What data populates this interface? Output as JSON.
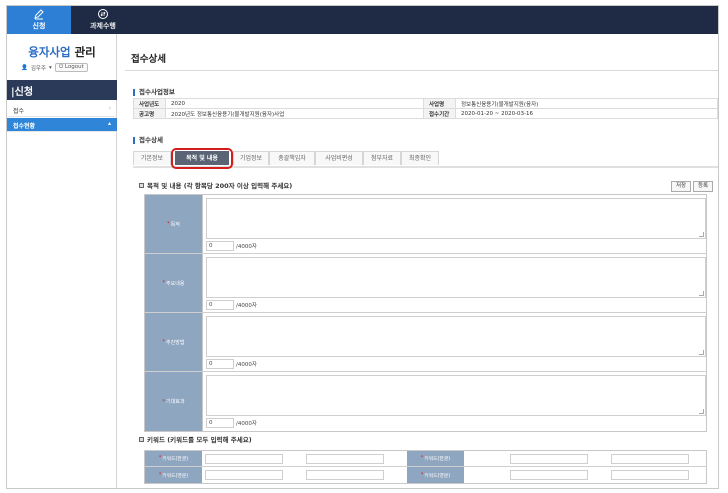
{
  "topnav": {
    "items": [
      {
        "label": "신청",
        "icon": "pencil-icon",
        "active": true
      },
      {
        "label": "과제수행",
        "icon": "cycle-icon",
        "active": false
      }
    ]
  },
  "sidebar": {
    "title_highlight": "융자사업",
    "title_rest": " 관리",
    "user_name": "김우주",
    "logout_label": "Logout",
    "section_label": "신청",
    "items": [
      {
        "label": "접수",
        "active": false
      },
      {
        "label": "접수현황",
        "active": true
      }
    ]
  },
  "main": {
    "page_title": "접수상세",
    "info_section_title": "접수사업정보",
    "info": {
      "row1": {
        "k1": "사업년도",
        "v1": "2020",
        "k2": "사업명",
        "v2": "정보통신융용기(물개발지원(융자)"
      },
      "row2": {
        "k1": "공고명",
        "v1": "2020년도 정보통신융용기(물개발지원(융자)사업",
        "k2": "접수기간",
        "v2": "2020-01-20 ~ 2020-03-16"
      }
    },
    "detail_section_title": "접수상세",
    "tabs": [
      "기본정보",
      "목적 및 내용",
      "기업정보",
      "총괄책임자",
      "사업비편성",
      "첨부자료",
      "최종확인"
    ],
    "active_tab_index": 1,
    "purpose": {
      "title": "목적 및 내용 (각 항목당 200자 이상 입력해 주세요)",
      "save_label": "저장",
      "register_label": "등록",
      "fields": [
        {
          "label": "목적",
          "count": "0",
          "limit": "/4000자"
        },
        {
          "label": "주요내용",
          "count": "0",
          "limit": "/4000자"
        },
        {
          "label": "추진방법",
          "count": "0",
          "limit": "/4000자"
        },
        {
          "label": "기대효과",
          "count": "0",
          "limit": "/4000자"
        }
      ]
    },
    "keywords": {
      "title": "키워드 (키워드를 모두 입력해 주세요)",
      "rows": [
        {
          "label": "키워드(한글)"
        },
        {
          "label": "키워드(영문)"
        }
      ]
    }
  },
  "colors": {
    "topbar": "#1f2a44",
    "accent": "#2d7fd6",
    "label_bg": "#8fa6c1",
    "highlight_ring": "#d31e1e"
  }
}
